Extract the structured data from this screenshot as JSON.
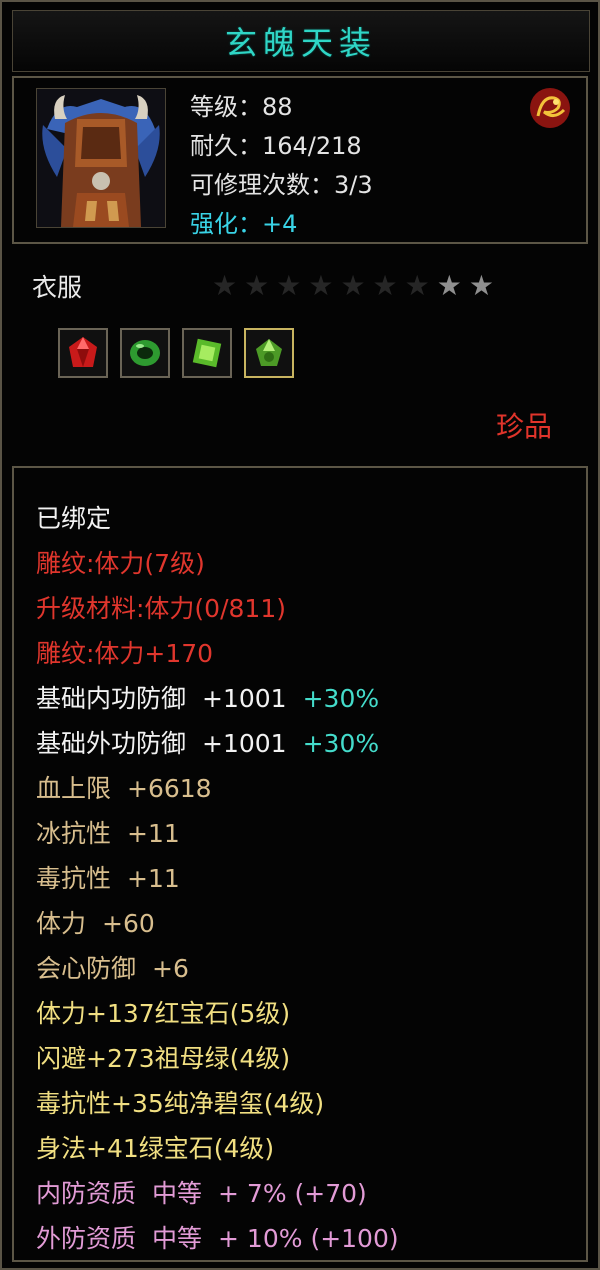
{
  "item": {
    "name": "玄魄天装",
    "level": "等级：88",
    "durability": "耐久：164/218",
    "repair": "可修理次数：3/3",
    "strengthen_label": "强化：",
    "strengthen_value": "+4",
    "type": "衣服",
    "rarity": "珍品",
    "stars_total": 9,
    "stars_lit": 2,
    "gems": [
      "red-gem-icon",
      "green-ring-gem-icon",
      "green-gem-icon",
      "green-crystal-gem-icon"
    ]
  },
  "stats": {
    "bound": "已绑定",
    "engrave1": "雕纹:体力(7级)",
    "upgrade_material": "升级材料:体力(0/811)",
    "engrave2": "雕纹:体力+170",
    "inner_def_label": "基础内功防御",
    "inner_def_value": "+1001",
    "inner_def_bonus": "+30%",
    "outer_def_label": "基础外功防御",
    "outer_def_value": "+1001",
    "outer_def_bonus": "+30%",
    "hp_label": "血上限",
    "hp_value": "+6618",
    "ice_label": "冰抗性",
    "ice_value": "+11",
    "poison_label": "毒抗性",
    "poison_value": "+11",
    "vit_label": "体力",
    "vit_value": "+60",
    "crit_label": "会心防御",
    "crit_value": "+6",
    "gem1": "体力+137红宝石(5级)",
    "gem2": "闪避+273祖母绿(4级)",
    "gem3": "毒抗性+35纯净碧玺(4级)",
    "gem4": "身法+41绿宝石(4级)",
    "q1_label": "内防资质",
    "q1_grade": "中等",
    "q1_value": "+ 7% (+70)",
    "q2_label": "外防资质",
    "q2_grade": "中等",
    "q2_value": "+ 10% (+100)"
  },
  "colors": {
    "title": "#2fd6c6",
    "red": "#e0362d",
    "gold": "#d8be8e",
    "cyan": "#44dccb",
    "yellow": "#f1df82",
    "pink": "#e29bd6"
  }
}
